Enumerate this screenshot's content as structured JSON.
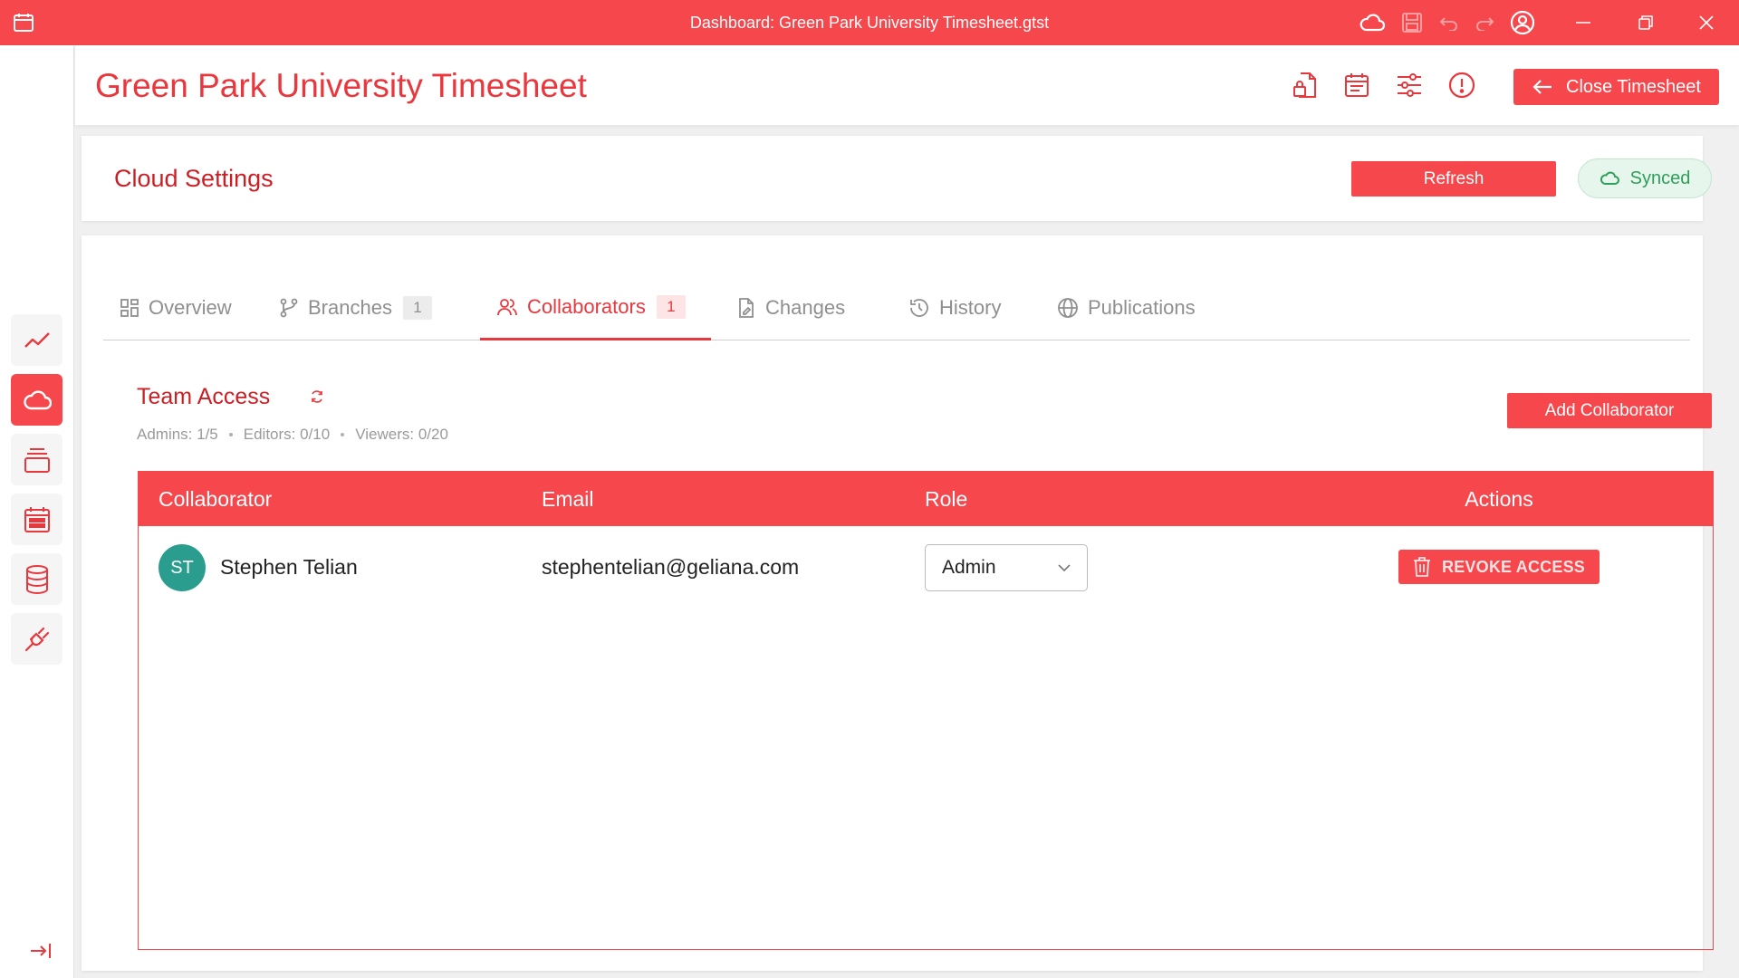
{
  "window": {
    "title": "Dashboard: Green Park University Timesheet.gtst",
    "icons": [
      "calendar-icon",
      "cloud-icon",
      "save-icon",
      "undo-icon",
      "redo-icon",
      "user-icon",
      "minimize-icon",
      "restore-icon",
      "close-icon"
    ]
  },
  "header": {
    "title": "Green Park University Timesheet",
    "close_label": "Close Timesheet",
    "icons": [
      "document-lock-icon",
      "calendar-icon",
      "sliders-icon",
      "alert-icon"
    ]
  },
  "sidebar": {
    "items": [
      {
        "icon": "trend-icon",
        "active": false
      },
      {
        "icon": "cloud-icon",
        "active": true
      },
      {
        "icon": "layers-icon",
        "active": false
      },
      {
        "icon": "calendar-grid-icon",
        "active": false
      },
      {
        "icon": "database-icon",
        "active": false
      },
      {
        "icon": "plug-icon",
        "active": false
      }
    ],
    "collapse_icon": "collapse-icon"
  },
  "settings": {
    "title": "Cloud Settings",
    "refresh_label": "Refresh",
    "status_label": "Synced",
    "status_color": "#2e9e5a"
  },
  "tabs": [
    {
      "label": "Overview",
      "icon": "grid-icon",
      "count": null,
      "active": false
    },
    {
      "label": "Branches",
      "icon": "branch-icon",
      "count": "1",
      "active": false
    },
    {
      "label": "Collaborators",
      "icon": "users-icon",
      "count": "1",
      "active": true
    },
    {
      "label": "Changes",
      "icon": "file-edit-icon",
      "count": null,
      "active": false
    },
    {
      "label": "History",
      "icon": "history-icon",
      "count": null,
      "active": false
    },
    {
      "label": "Publications",
      "icon": "globe-icon",
      "count": null,
      "active": false
    }
  ],
  "team": {
    "title": "Team Access",
    "limits": [
      "Admins: 1/5",
      "Editors: 0/10",
      "Viewers: 0/20"
    ],
    "add_label": "Add Collaborator",
    "columns": [
      "Collaborator",
      "Email",
      "Role",
      "Actions"
    ],
    "rows": [
      {
        "initials": "ST",
        "name": "Stephen Telian",
        "email": "stephentelian@geliana.com",
        "role": "Admin",
        "action": "REVOKE ACCESS"
      }
    ]
  },
  "colors": {
    "accent": "#f5474c",
    "accent_dark": "#cc1f25",
    "avatar": "#2a9d8f"
  }
}
